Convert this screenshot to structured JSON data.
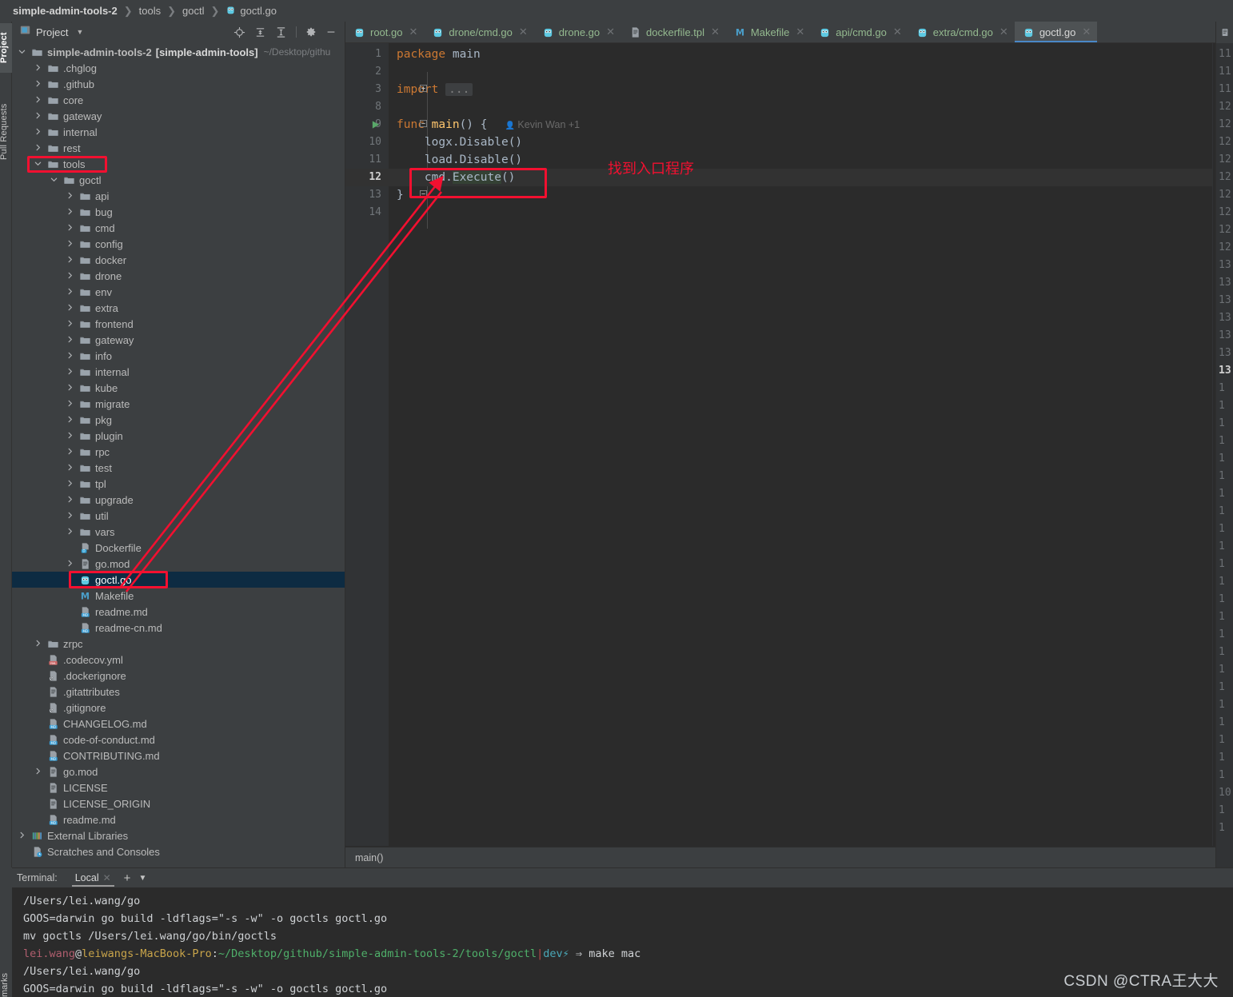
{
  "breadcrumb": {
    "items": [
      "simple-admin-tools-2",
      "tools",
      "goctl",
      "goctl.go"
    ]
  },
  "left_strip": {
    "tabs": [
      "Project",
      "Pull Requests"
    ],
    "bottom_tab": "marks"
  },
  "project_panel": {
    "title": "Project",
    "tree": [
      {
        "depth": 0,
        "arrow": "down",
        "icon": "folder",
        "label": "simple-admin-tools-2",
        "bold_suffix": "[simple-admin-tools]",
        "path": "~/Desktop/githu"
      },
      {
        "depth": 1,
        "arrow": "right",
        "icon": "folder",
        "label": ".chglog"
      },
      {
        "depth": 1,
        "arrow": "right",
        "icon": "folder",
        "label": ".github"
      },
      {
        "depth": 1,
        "arrow": "right",
        "icon": "folder",
        "label": "core"
      },
      {
        "depth": 1,
        "arrow": "right",
        "icon": "folder",
        "label": "gateway"
      },
      {
        "depth": 1,
        "arrow": "right",
        "icon": "folder",
        "label": "internal"
      },
      {
        "depth": 1,
        "arrow": "right",
        "icon": "folder",
        "label": "rest"
      },
      {
        "depth": 1,
        "arrow": "down",
        "icon": "folder",
        "label": "tools",
        "annotated": true
      },
      {
        "depth": 2,
        "arrow": "down",
        "icon": "folder",
        "label": "goctl"
      },
      {
        "depth": 3,
        "arrow": "right",
        "icon": "folder",
        "label": "api"
      },
      {
        "depth": 3,
        "arrow": "right",
        "icon": "folder",
        "label": "bug"
      },
      {
        "depth": 3,
        "arrow": "right",
        "icon": "folder",
        "label": "cmd"
      },
      {
        "depth": 3,
        "arrow": "right",
        "icon": "folder",
        "label": "config"
      },
      {
        "depth": 3,
        "arrow": "right",
        "icon": "folder",
        "label": "docker"
      },
      {
        "depth": 3,
        "arrow": "right",
        "icon": "folder",
        "label": "drone"
      },
      {
        "depth": 3,
        "arrow": "right",
        "icon": "folder",
        "label": "env"
      },
      {
        "depth": 3,
        "arrow": "right",
        "icon": "folder",
        "label": "extra"
      },
      {
        "depth": 3,
        "arrow": "right",
        "icon": "folder",
        "label": "frontend"
      },
      {
        "depth": 3,
        "arrow": "right",
        "icon": "folder",
        "label": "gateway"
      },
      {
        "depth": 3,
        "arrow": "right",
        "icon": "folder",
        "label": "info"
      },
      {
        "depth": 3,
        "arrow": "right",
        "icon": "folder",
        "label": "internal"
      },
      {
        "depth": 3,
        "arrow": "right",
        "icon": "folder",
        "label": "kube"
      },
      {
        "depth": 3,
        "arrow": "right",
        "icon": "folder",
        "label": "migrate"
      },
      {
        "depth": 3,
        "arrow": "right",
        "icon": "folder",
        "label": "pkg"
      },
      {
        "depth": 3,
        "arrow": "right",
        "icon": "folder",
        "label": "plugin"
      },
      {
        "depth": 3,
        "arrow": "right",
        "icon": "folder",
        "label": "rpc"
      },
      {
        "depth": 3,
        "arrow": "right",
        "icon": "folder",
        "label": "test"
      },
      {
        "depth": 3,
        "arrow": "right",
        "icon": "folder",
        "label": "tpl"
      },
      {
        "depth": 3,
        "arrow": "right",
        "icon": "folder",
        "label": "upgrade"
      },
      {
        "depth": 3,
        "arrow": "right",
        "icon": "folder",
        "label": "util"
      },
      {
        "depth": 3,
        "arrow": "right",
        "icon": "folder",
        "label": "vars"
      },
      {
        "depth": 3,
        "arrow": "none",
        "icon": "docker",
        "label": "Dockerfile"
      },
      {
        "depth": 3,
        "arrow": "right",
        "icon": "file",
        "label": "go.mod"
      },
      {
        "depth": 3,
        "arrow": "none",
        "icon": "go",
        "label": "goctl.go",
        "selected": true,
        "annotated": true
      },
      {
        "depth": 3,
        "arrow": "none",
        "icon": "makefile",
        "label": "Makefile"
      },
      {
        "depth": 3,
        "arrow": "none",
        "icon": "md",
        "label": "readme.md"
      },
      {
        "depth": 3,
        "arrow": "none",
        "icon": "md",
        "label": "readme-cn.md"
      },
      {
        "depth": 1,
        "arrow": "right",
        "icon": "folder",
        "label": "zrpc"
      },
      {
        "depth": 1,
        "arrow": "none",
        "icon": "yml",
        "label": ".codecov.yml"
      },
      {
        "depth": 1,
        "arrow": "none",
        "icon": "ignore",
        "label": ".dockerignore"
      },
      {
        "depth": 1,
        "arrow": "none",
        "icon": "file",
        "label": ".gitattributes"
      },
      {
        "depth": 1,
        "arrow": "none",
        "icon": "ignore",
        "label": ".gitignore"
      },
      {
        "depth": 1,
        "arrow": "none",
        "icon": "md",
        "label": "CHANGELOG.md"
      },
      {
        "depth": 1,
        "arrow": "none",
        "icon": "md",
        "label": "code-of-conduct.md"
      },
      {
        "depth": 1,
        "arrow": "none",
        "icon": "md",
        "label": "CONTRIBUTING.md"
      },
      {
        "depth": 1,
        "arrow": "right",
        "icon": "file",
        "label": "go.mod"
      },
      {
        "depth": 1,
        "arrow": "none",
        "icon": "file",
        "label": "LICENSE"
      },
      {
        "depth": 1,
        "arrow": "none",
        "icon": "file",
        "label": "LICENSE_ORIGIN"
      },
      {
        "depth": 1,
        "arrow": "none",
        "icon": "md",
        "label": "readme.md"
      },
      {
        "depth": 0,
        "arrow": "right",
        "icon": "library",
        "label": "External Libraries"
      },
      {
        "depth": 0,
        "arrow": "none",
        "icon": "scratch",
        "label": "Scratches and Consoles"
      }
    ],
    "toolbar_icons": [
      "locate-icon",
      "expand-all-icon",
      "collapse-all-icon",
      "gear-icon",
      "minimize-icon"
    ]
  },
  "editor": {
    "tabs": [
      {
        "label": "root.go",
        "icon": "go",
        "active": false
      },
      {
        "label": "drone/cmd.go",
        "icon": "go",
        "active": false
      },
      {
        "label": "drone.go",
        "icon": "go",
        "active": false
      },
      {
        "label": "dockerfile.tpl",
        "icon": "file",
        "active": false
      },
      {
        "label": "Makefile",
        "icon": "makefile",
        "active": false
      },
      {
        "label": "api/cmd.go",
        "icon": "go",
        "active": false
      },
      {
        "label": "extra/cmd.go",
        "icon": "go",
        "active": false
      },
      {
        "label": "goctl.go",
        "icon": "go",
        "active": true
      }
    ],
    "line_numbers": [
      "1",
      "2",
      "3",
      "8",
      "9",
      "10",
      "11",
      "12",
      "13",
      "14"
    ],
    "current_line": "12",
    "code_lines": [
      {
        "n": "1",
        "tokens": [
          {
            "t": "package ",
            "c": "kw"
          },
          {
            "t": "main",
            "c": "plain"
          }
        ]
      },
      {
        "n": "2",
        "tokens": []
      },
      {
        "n": "3",
        "fold": "+",
        "tokens": [
          {
            "t": "import ",
            "c": "kw"
          },
          {
            "t": "...",
            "c": "dots"
          }
        ]
      },
      {
        "n": "8",
        "tokens": []
      },
      {
        "n": "9",
        "fold": "-",
        "run": true,
        "tokens": [
          {
            "t": "func ",
            "c": "kw"
          },
          {
            "t": "main",
            "c": "fn"
          },
          {
            "t": "() {",
            "c": "plain"
          }
        ],
        "vcs": "Kevin Wan +1"
      },
      {
        "n": "10",
        "tokens": [
          {
            "t": "    logx",
            "c": "plain"
          },
          {
            "t": ".",
            "c": "plain"
          },
          {
            "t": "Disable",
            "c": "meth"
          },
          {
            "t": "()",
            "c": "plain"
          }
        ]
      },
      {
        "n": "11",
        "tokens": [
          {
            "t": "    load",
            "c": "plain"
          },
          {
            "t": ".",
            "c": "plain"
          },
          {
            "t": "Disable",
            "c": "meth"
          },
          {
            "t": "()",
            "c": "plain"
          }
        ]
      },
      {
        "n": "12",
        "cur": true,
        "tokens": [
          {
            "t": "    cmd",
            "c": "plain"
          },
          {
            "t": ".",
            "c": "plain"
          },
          {
            "t": "Execute",
            "c": "sel"
          },
          {
            "t": "()",
            "c": "plain"
          }
        ]
      },
      {
        "n": "13",
        "fold": "-",
        "tokens": [
          {
            "t": "}",
            "c": "plain"
          }
        ]
      },
      {
        "n": "14",
        "tokens": []
      }
    ],
    "bottom_breadcrumb": "main()",
    "status_ok_icon": "checkmark-icon"
  },
  "editor_right_pane": {
    "line_numbers": [
      "11",
      "11",
      "11",
      "12",
      "12",
      "12",
      "12",
      "12",
      "12",
      "12",
      "12",
      "12",
      "13",
      "13",
      "13",
      "13",
      "13",
      "13",
      "13",
      "1",
      "1",
      "1",
      "1",
      "1",
      "1",
      "1",
      "1",
      "1",
      "1",
      "1",
      "1",
      "1",
      "1",
      "1",
      "1",
      "1",
      "1",
      "1",
      "1",
      "1",
      "1",
      "1",
      "10",
      "1",
      "1"
    ],
    "bold_index": 18
  },
  "terminal": {
    "label": "Terminal:",
    "tab": "Local",
    "lines": [
      {
        "type": "plain",
        "text": "/Users/lei.wang/go"
      },
      {
        "type": "plain",
        "text": "GOOS=darwin go build -ldflags=\"-s -w\" -o goctls goctl.go"
      },
      {
        "type": "plain",
        "text": "mv goctls /Users/lei.wang/go/bin/goctls"
      },
      {
        "type": "prompt",
        "user": "lei.wang",
        "at": "@",
        "host": "leiwangs-MacBook-Pro",
        "colon": ":",
        "path": "~/Desktop/github/simple-admin-tools-2/tools/goctl",
        "pipe": "|",
        "branch": "dev⚡",
        "arrow": "⇒",
        "command": "make mac"
      },
      {
        "type": "plain",
        "text": "/Users/lei.wang/go"
      },
      {
        "type": "plain",
        "text": "GOOS=darwin go build -ldflags=\"-s -w\" -o goctls goctl.go"
      }
    ]
  },
  "annotations": {
    "note_text": "找到入口程序",
    "color": "#f21030"
  },
  "watermark": "CSDN @CTRA王大大"
}
